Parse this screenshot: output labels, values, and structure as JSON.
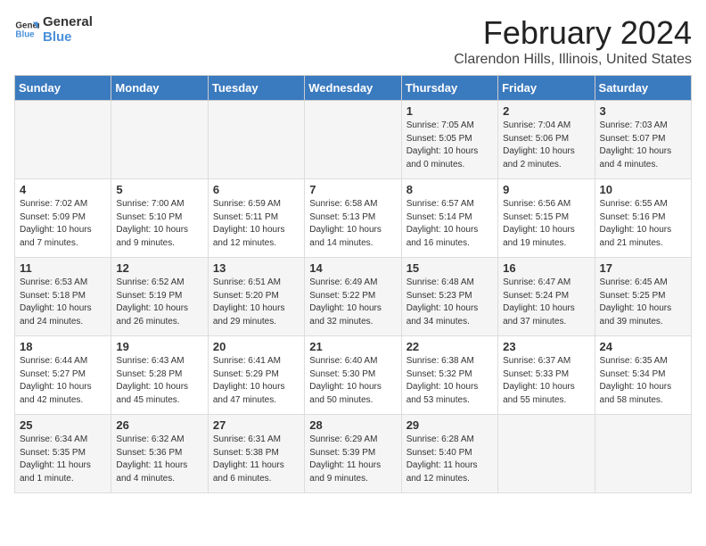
{
  "header": {
    "logo_line1": "General",
    "logo_line2": "Blue",
    "main_title": "February 2024",
    "subtitle": "Clarendon Hills, Illinois, United States"
  },
  "days_of_week": [
    "Sunday",
    "Monday",
    "Tuesday",
    "Wednesday",
    "Thursday",
    "Friday",
    "Saturday"
  ],
  "weeks": [
    [
      {
        "day": "",
        "content": ""
      },
      {
        "day": "",
        "content": ""
      },
      {
        "day": "",
        "content": ""
      },
      {
        "day": "",
        "content": ""
      },
      {
        "day": "1",
        "content": "Sunrise: 7:05 AM\nSunset: 5:05 PM\nDaylight: 10 hours\nand 0 minutes."
      },
      {
        "day": "2",
        "content": "Sunrise: 7:04 AM\nSunset: 5:06 PM\nDaylight: 10 hours\nand 2 minutes."
      },
      {
        "day": "3",
        "content": "Sunrise: 7:03 AM\nSunset: 5:07 PM\nDaylight: 10 hours\nand 4 minutes."
      }
    ],
    [
      {
        "day": "4",
        "content": "Sunrise: 7:02 AM\nSunset: 5:09 PM\nDaylight: 10 hours\nand 7 minutes."
      },
      {
        "day": "5",
        "content": "Sunrise: 7:00 AM\nSunset: 5:10 PM\nDaylight: 10 hours\nand 9 minutes."
      },
      {
        "day": "6",
        "content": "Sunrise: 6:59 AM\nSunset: 5:11 PM\nDaylight: 10 hours\nand 12 minutes."
      },
      {
        "day": "7",
        "content": "Sunrise: 6:58 AM\nSunset: 5:13 PM\nDaylight: 10 hours\nand 14 minutes."
      },
      {
        "day": "8",
        "content": "Sunrise: 6:57 AM\nSunset: 5:14 PM\nDaylight: 10 hours\nand 16 minutes."
      },
      {
        "day": "9",
        "content": "Sunrise: 6:56 AM\nSunset: 5:15 PM\nDaylight: 10 hours\nand 19 minutes."
      },
      {
        "day": "10",
        "content": "Sunrise: 6:55 AM\nSunset: 5:16 PM\nDaylight: 10 hours\nand 21 minutes."
      }
    ],
    [
      {
        "day": "11",
        "content": "Sunrise: 6:53 AM\nSunset: 5:18 PM\nDaylight: 10 hours\nand 24 minutes."
      },
      {
        "day": "12",
        "content": "Sunrise: 6:52 AM\nSunset: 5:19 PM\nDaylight: 10 hours\nand 26 minutes."
      },
      {
        "day": "13",
        "content": "Sunrise: 6:51 AM\nSunset: 5:20 PM\nDaylight: 10 hours\nand 29 minutes."
      },
      {
        "day": "14",
        "content": "Sunrise: 6:49 AM\nSunset: 5:22 PM\nDaylight: 10 hours\nand 32 minutes."
      },
      {
        "day": "15",
        "content": "Sunrise: 6:48 AM\nSunset: 5:23 PM\nDaylight: 10 hours\nand 34 minutes."
      },
      {
        "day": "16",
        "content": "Sunrise: 6:47 AM\nSunset: 5:24 PM\nDaylight: 10 hours\nand 37 minutes."
      },
      {
        "day": "17",
        "content": "Sunrise: 6:45 AM\nSunset: 5:25 PM\nDaylight: 10 hours\nand 39 minutes."
      }
    ],
    [
      {
        "day": "18",
        "content": "Sunrise: 6:44 AM\nSunset: 5:27 PM\nDaylight: 10 hours\nand 42 minutes."
      },
      {
        "day": "19",
        "content": "Sunrise: 6:43 AM\nSunset: 5:28 PM\nDaylight: 10 hours\nand 45 minutes."
      },
      {
        "day": "20",
        "content": "Sunrise: 6:41 AM\nSunset: 5:29 PM\nDaylight: 10 hours\nand 47 minutes."
      },
      {
        "day": "21",
        "content": "Sunrise: 6:40 AM\nSunset: 5:30 PM\nDaylight: 10 hours\nand 50 minutes."
      },
      {
        "day": "22",
        "content": "Sunrise: 6:38 AM\nSunset: 5:32 PM\nDaylight: 10 hours\nand 53 minutes."
      },
      {
        "day": "23",
        "content": "Sunrise: 6:37 AM\nSunset: 5:33 PM\nDaylight: 10 hours\nand 55 minutes."
      },
      {
        "day": "24",
        "content": "Sunrise: 6:35 AM\nSunset: 5:34 PM\nDaylight: 10 hours\nand 58 minutes."
      }
    ],
    [
      {
        "day": "25",
        "content": "Sunrise: 6:34 AM\nSunset: 5:35 PM\nDaylight: 11 hours\nand 1 minute."
      },
      {
        "day": "26",
        "content": "Sunrise: 6:32 AM\nSunset: 5:36 PM\nDaylight: 11 hours\nand 4 minutes."
      },
      {
        "day": "27",
        "content": "Sunrise: 6:31 AM\nSunset: 5:38 PM\nDaylight: 11 hours\nand 6 minutes."
      },
      {
        "day": "28",
        "content": "Sunrise: 6:29 AM\nSunset: 5:39 PM\nDaylight: 11 hours\nand 9 minutes."
      },
      {
        "day": "29",
        "content": "Sunrise: 6:28 AM\nSunset: 5:40 PM\nDaylight: 11 hours\nand 12 minutes."
      },
      {
        "day": "",
        "content": ""
      },
      {
        "day": "",
        "content": ""
      }
    ]
  ]
}
